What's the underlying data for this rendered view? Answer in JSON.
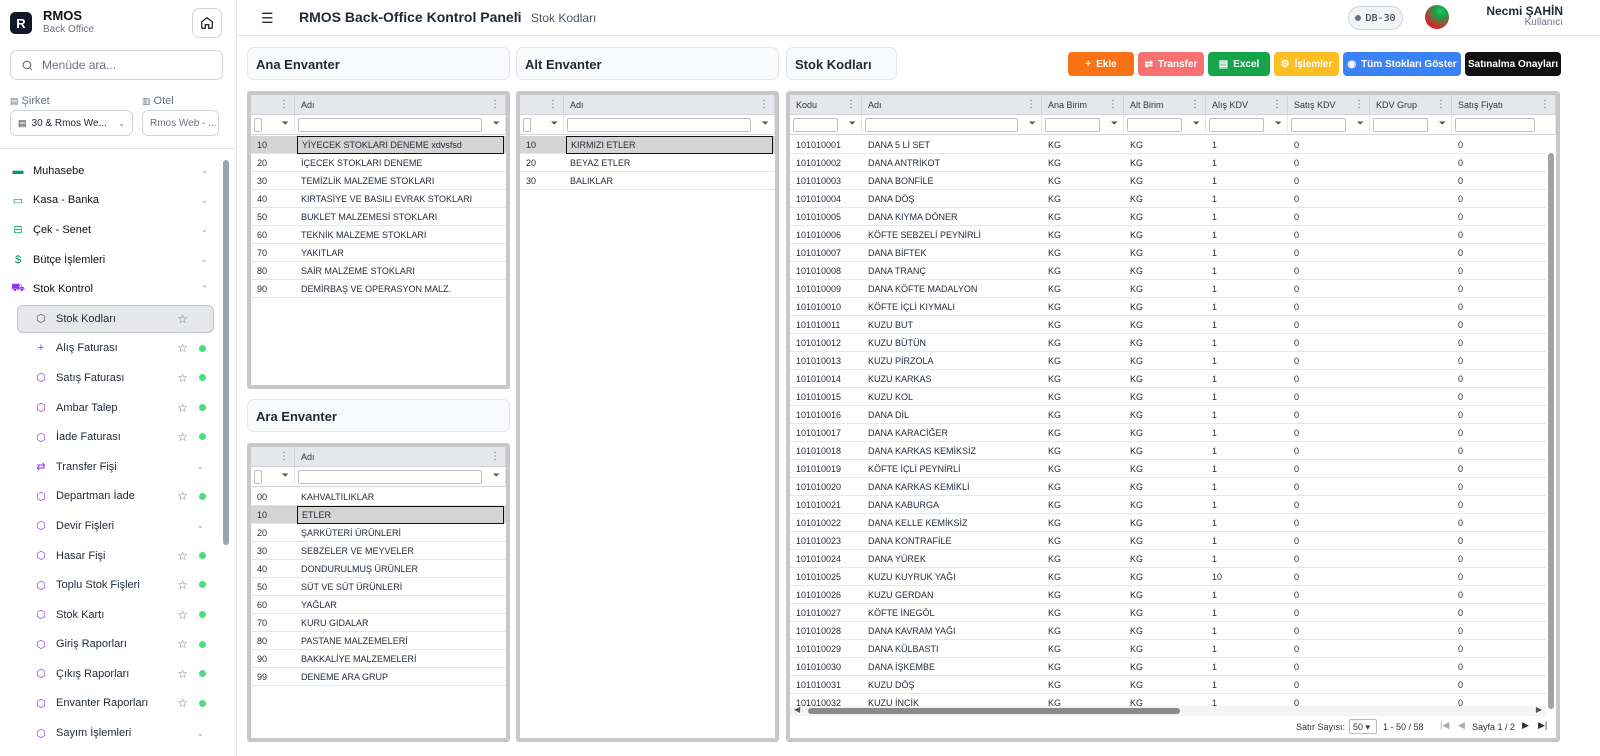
{
  "app": {
    "name": "RMOS",
    "subtitle": "Back Office",
    "search_placeholder": "Menüde ara..."
  },
  "filters": {
    "company_label": "Şirket",
    "company_value": "30 & Rmos We...",
    "hotel_label": "Otel",
    "hotel_value": "Rmos Web - ..."
  },
  "menu": [
    {
      "label": "Muhasebe",
      "icon": "book-icon",
      "color": "#059669"
    },
    {
      "label": "Kasa - Banka",
      "icon": "card-icon",
      "color": "#059669"
    },
    {
      "label": "Çek - Senet",
      "icon": "banknote-icon",
      "color": "#059669"
    },
    {
      "label": "Bütçe İşlemleri",
      "icon": "dollar-icon",
      "color": "#059669"
    },
    {
      "label": "Stok Kontrol",
      "icon": "cart-icon",
      "color": "#9333ea"
    }
  ],
  "submenu": [
    {
      "label": "Stok Kodları"
    },
    {
      "label": "Alış Faturası"
    },
    {
      "label": "Satış Faturası"
    },
    {
      "label": "Ambar Talep"
    },
    {
      "label": "İade Faturası"
    },
    {
      "label": "Transfer Fişi"
    },
    {
      "label": "Departman İade"
    },
    {
      "label": "Devir Fişleri"
    },
    {
      "label": "Hasar Fişi"
    },
    {
      "label": "Toplu Stok Fişleri"
    },
    {
      "label": "Stok Kartı"
    },
    {
      "label": "Giriş Raporları"
    },
    {
      "label": "Çıkış Raporları"
    },
    {
      "label": "Envanter Raporları"
    },
    {
      "label": "Sayım İşlemleri"
    }
  ],
  "header": {
    "title": "RMOS Back-Office Kontrol Paneli",
    "breadcrumb": "Stok Kodları",
    "db": "DB-30",
    "user_name": "Necmi ŞAHİN",
    "user_role": "Kullanıcı"
  },
  "panels": {
    "ana": "Ana Envanter",
    "alt": "Alt Envanter",
    "ara": "Ara Envanter",
    "stok": "Stok Kodları"
  },
  "buttons": {
    "ekle": "Ekle",
    "transfer": "Transfer",
    "excel": "Excel",
    "islemler": "İşlemler",
    "tum": "Tüm Stokları Göster",
    "satinalma": "Satınalma Onayları"
  },
  "grid_headers": {
    "adi": "Adı",
    "kodu": "Kodu",
    "ana_birim": "Ana Birim",
    "alt_birim": "Alt Birim",
    "alis_kdv": "Alış KDV",
    "satis_kdv": "Satış KDV",
    "kdv_grup": "KDV Grup",
    "satis_fiyati": "Satış Fiyatı"
  },
  "ana_envanter": [
    [
      "10",
      "YİYECEK STOKLARI DENEME xdvsfsd"
    ],
    [
      "20",
      "İÇECEK STOKLARI DENEME"
    ],
    [
      "30",
      "TEMİZLİK MALZEME STOKLARI"
    ],
    [
      "40",
      "KIRTASİYE VE BASILI EVRAK STOKLARI"
    ],
    [
      "50",
      "BUKLET MALZEMESİ STOKLARI"
    ],
    [
      "60",
      "TEKNİK MALZEME STOKLARI"
    ],
    [
      "70",
      "YAKITLAR"
    ],
    [
      "80",
      "SAİR MALZEME STOKLARI"
    ],
    [
      "90",
      "DEMİRBAŞ VE OPERASYON MALZ."
    ]
  ],
  "alt_envanter": [
    [
      "10",
      "KIRMIZI ETLER"
    ],
    [
      "20",
      "BEYAZ ETLER"
    ],
    [
      "30",
      "BALIKLAR"
    ]
  ],
  "ara_envanter": [
    [
      "00",
      "KAHVALTILIKLAR"
    ],
    [
      "10",
      "ETLER"
    ],
    [
      "20",
      "ŞARKÜTERİ ÜRÜNLERİ"
    ],
    [
      "30",
      "SEBZELER VE MEYVELER"
    ],
    [
      "40",
      "DONDURULMUŞ ÜRÜNLER"
    ],
    [
      "50",
      "SÜT VE SÜT ÜRÜNLERİ"
    ],
    [
      "60",
      "YAĞLAR"
    ],
    [
      "70",
      "KURU GIDALAR"
    ],
    [
      "80",
      "PASTANE MALZEMELERİ"
    ],
    [
      "90",
      "BAKKALİYE MALZEMELERİ"
    ],
    [
      "99",
      "DENEME ARA GRUP"
    ]
  ],
  "stok_kodlari": [
    [
      "101010001",
      "DANA 5 Lİ SET",
      "KG",
      "KG",
      "1",
      "0",
      "",
      "0"
    ],
    [
      "101010002",
      "DANA ANTRİKOT",
      "KG",
      "KG",
      "1",
      "0",
      "",
      "0"
    ],
    [
      "101010003",
      "DANA BONFİLE",
      "KG",
      "KG",
      "1",
      "0",
      "",
      "0"
    ],
    [
      "101010004",
      "DANA DÖŞ",
      "KG",
      "KG",
      "1",
      "0",
      "",
      "0"
    ],
    [
      "101010005",
      "DANA KIYMA DÖNER",
      "KG",
      "KG",
      "1",
      "0",
      "",
      "0"
    ],
    [
      "101010006",
      "KÖFTE SEBZELİ PEYNİRLİ",
      "KG",
      "KG",
      "1",
      "0",
      "",
      "0"
    ],
    [
      "101010007",
      "DANA BİFTEK",
      "KG",
      "KG",
      "1",
      "0",
      "",
      "0"
    ],
    [
      "101010008",
      "DANA TRANÇ",
      "KG",
      "KG",
      "1",
      "0",
      "",
      "0"
    ],
    [
      "101010009",
      "DANA KÖFTE MADALYON",
      "KG",
      "KG",
      "1",
      "0",
      "",
      "0"
    ],
    [
      "101010010",
      "KÖFTE İÇLİ KIYMALI",
      "KG",
      "KG",
      "1",
      "0",
      "",
      "0"
    ],
    [
      "101010011",
      "KUZU BUT",
      "KG",
      "KG",
      "1",
      "0",
      "",
      "0"
    ],
    [
      "101010012",
      "KUZU BÜTÜN",
      "KG",
      "KG",
      "1",
      "0",
      "",
      "0"
    ],
    [
      "101010013",
      "KUZU PİRZOLA",
      "KG",
      "KG",
      "1",
      "0",
      "",
      "0"
    ],
    [
      "101010014",
      "KUZU KARKAS",
      "KG",
      "KG",
      "1",
      "0",
      "",
      "0"
    ],
    [
      "101010015",
      "KUZU KOL",
      "KG",
      "KG",
      "1",
      "0",
      "",
      "0"
    ],
    [
      "101010016",
      "DANA DİL",
      "KG",
      "KG",
      "1",
      "0",
      "",
      "0"
    ],
    [
      "101010017",
      "DANA KARACİĞER",
      "KG",
      "KG",
      "1",
      "0",
      "",
      "0"
    ],
    [
      "101010018",
      "DANA KARKAS KEMİKSİZ",
      "KG",
      "KG",
      "1",
      "0",
      "",
      "0"
    ],
    [
      "101010019",
      "KÖFTE İÇLİ PEYNİRLİ",
      "KG",
      "KG",
      "1",
      "0",
      "",
      "0"
    ],
    [
      "101010020",
      "DANA KARKAS KEMİKLİ",
      "KG",
      "KG",
      "1",
      "0",
      "",
      "0"
    ],
    [
      "101010021",
      "DANA KABURGA",
      "KG",
      "KG",
      "1",
      "0",
      "",
      "0"
    ],
    [
      "101010022",
      "DANA KELLE KEMİKSİZ",
      "KG",
      "KG",
      "1",
      "0",
      "",
      "0"
    ],
    [
      "101010023",
      "DANA KONTRAFİLE",
      "KG",
      "KG",
      "1",
      "0",
      "",
      "0"
    ],
    [
      "101010024",
      "DANA YÜREK",
      "KG",
      "KG",
      "1",
      "0",
      "",
      "0"
    ],
    [
      "101010025",
      "KUZU KUYRUK YAĞI",
      "KG",
      "KG",
      "10",
      "0",
      "",
      "0"
    ],
    [
      "101010026",
      "KUZU GERDAN",
      "KG",
      "KG",
      "1",
      "0",
      "",
      "0"
    ],
    [
      "101010027",
      "KÖFTE İNEGÖL",
      "KG",
      "KG",
      "1",
      "0",
      "",
      "0"
    ],
    [
      "101010028",
      "DANA KAVRAM YAĞI",
      "KG",
      "KG",
      "1",
      "0",
      "",
      "0"
    ],
    [
      "101010029",
      "DANA KÜLBASTI",
      "KG",
      "KG",
      "1",
      "0",
      "",
      "0"
    ],
    [
      "101010030",
      "DANA İŞKEMBE",
      "KG",
      "KG",
      "1",
      "0",
      "",
      "0"
    ],
    [
      "101010031",
      "KUZU DÖŞ",
      "KG",
      "KG",
      "1",
      "0",
      "",
      "0"
    ],
    [
      "101010032",
      "KUZU İNCİK",
      "KG",
      "KG",
      "1",
      "0",
      "",
      "0"
    ]
  ],
  "pagination": {
    "rows_label": "Satır Sayısı:",
    "rows_value": "50",
    "range": "1 - 50 / 58",
    "page": "Sayfa 1 / 2"
  }
}
